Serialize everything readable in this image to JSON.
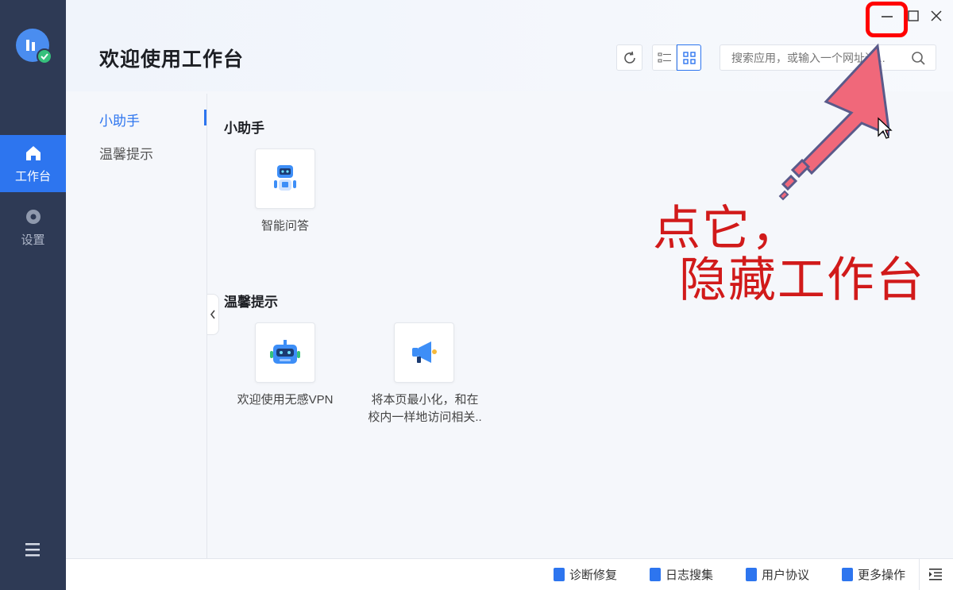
{
  "header": {
    "title": "欢迎使用工作台",
    "search_placeholder": "搜索应用，或输入一个网址进..."
  },
  "rail": {
    "items": [
      {
        "label": "工作台",
        "icon": "home-icon",
        "active": true
      },
      {
        "label": "设置",
        "icon": "gear-icon",
        "active": false
      }
    ]
  },
  "subnav": {
    "items": [
      {
        "label": "小助手",
        "active": true
      },
      {
        "label": "温馨提示",
        "active": false
      }
    ]
  },
  "sections": [
    {
      "title": "小助手",
      "apps": [
        {
          "label": "智能问答",
          "icon": "robot-assistant-icon"
        }
      ]
    },
    {
      "title": "温馨提示",
      "apps": [
        {
          "label": "欢迎使用无感VPN",
          "icon": "robot-face-icon"
        },
        {
          "label_line1": "将本页最小化，和在",
          "label_line2": "校内一样地访问相关..",
          "icon": "megaphone-icon"
        }
      ]
    }
  ],
  "footer": {
    "diagnose": "诊断修复",
    "log_collect": "日志搜集",
    "user_agreement": "用户协议",
    "more_actions": "更多操作"
  },
  "annotation": {
    "line1": "点它，",
    "line2": "隐藏工作台",
    "color": "#d11a1a"
  },
  "colors": {
    "accent": "#2d75ef",
    "rail_bg": "#2e3a55"
  }
}
